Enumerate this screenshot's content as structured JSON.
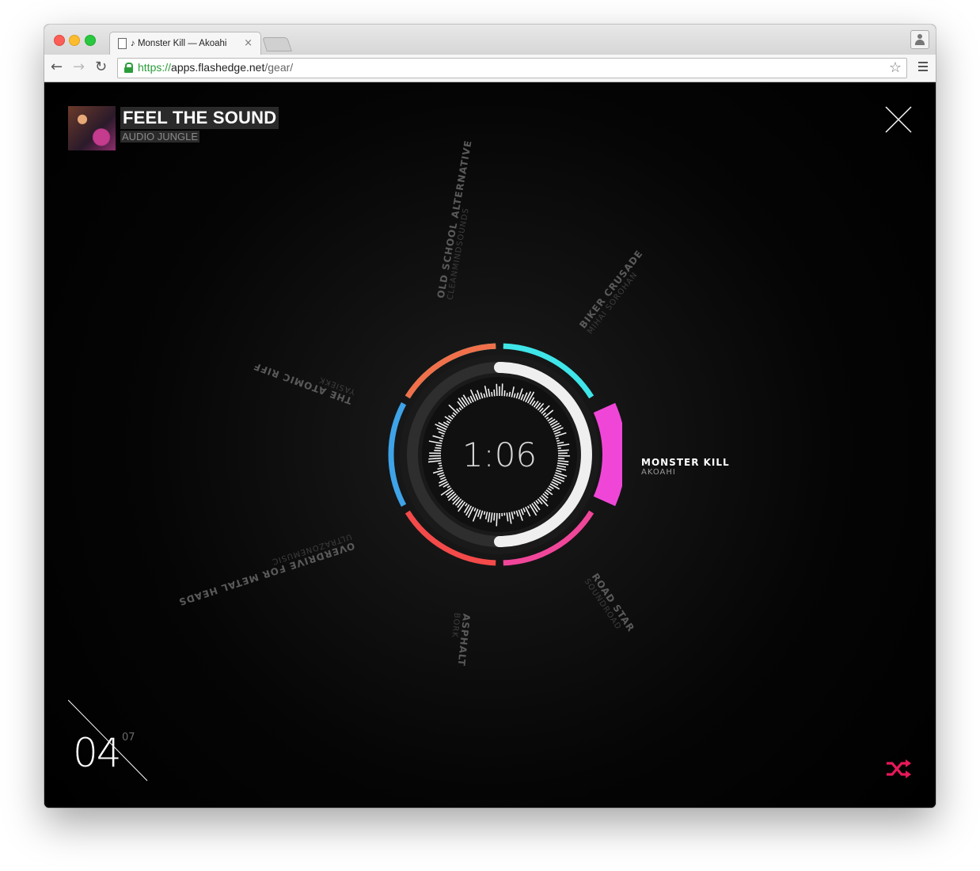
{
  "browser": {
    "tab_title": "♪ Monster Kill — Akoahi",
    "tab_close": "×",
    "url_scheme": "https://",
    "url_host": "apps.flashedge.net",
    "url_path": "/gear/",
    "back_glyph": "←",
    "forward_glyph": "→",
    "reload_glyph": "↻",
    "star_glyph": "☆"
  },
  "now_playing": {
    "title": "FEEL THE SOUND",
    "artist": "AUDIO JUNGLE",
    "time": "1:06"
  },
  "tracks": [
    {
      "title": "OLD SCHOOL ALTERNATIVE",
      "artist": "CLEANMINDSOUNDS",
      "active": false
    },
    {
      "title": "BIKER CRUSADE",
      "artist": "MIHAI SOROHAN",
      "active": false
    },
    {
      "title": "MONSTER KILL",
      "artist": "AKOAHI",
      "active": true
    },
    {
      "title": "ROAD STAR",
      "artist": "SOUNDROAD",
      "active": false
    },
    {
      "title": "ASPHALT",
      "artist": "BORK",
      "active": false
    },
    {
      "title": "OVERDRIVE FOR METAL HEADS",
      "artist": "ULTRAZONEMUSIC",
      "active": false
    },
    {
      "title": "THE ATOMIC RIFF",
      "artist": "YASIEKK",
      "active": false
    }
  ],
  "counter": {
    "current": "04",
    "total": "07"
  },
  "progress": {
    "fraction": 0.5
  },
  "colors": {
    "segment_1": "#3ce6d2",
    "segment_2": "#3fe5e8",
    "segment_active": "#f046d8",
    "segment_4": "#f0469a",
    "segment_5": "#f44a4a",
    "segment_6": "#3fa3e8",
    "segment_7": "#f0704a",
    "shuffle": "#e8185a"
  },
  "icons": {
    "close": "close-icon",
    "shuffle": "shuffle-icon",
    "lock": "lock-icon",
    "profile": "profile-icon",
    "menu": "menu-icon"
  }
}
